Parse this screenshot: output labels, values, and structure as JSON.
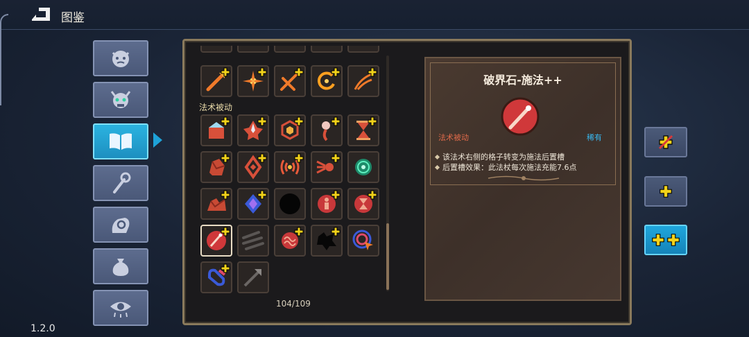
{
  "header": {
    "title": "图鉴"
  },
  "version": "1.2.0",
  "categories": [
    {
      "icon": "demon-face-icon",
      "active": false
    },
    {
      "icon": "horned-skull-icon",
      "active": false
    },
    {
      "icon": "book-icon",
      "active": true
    },
    {
      "icon": "staff-icon",
      "active": false
    },
    {
      "icon": "hand-orb-icon",
      "active": false
    },
    {
      "icon": "pouch-icon",
      "active": false
    },
    {
      "icon": "eye-icon",
      "active": false
    }
  ],
  "grid": {
    "section_label": "法术被动",
    "counter": "104/109",
    "top_row": [
      "fire-arrow-spell-icon",
      "flame-burst-spell-icon",
      "twin-fire-spell-icon",
      "fire-ring-spell-icon",
      "fire-claw-spell-icon"
    ],
    "passive_items": [
      [
        "ice-block-icon",
        "crystal-flower-icon",
        "hex-gem-icon",
        "spirit-wisp-icon",
        "hourglass-icon"
      ],
      [
        "rock-chunk-icon",
        "diamond-rune-icon",
        "signal-wave-icon",
        "triple-shot-icon",
        "green-orb-icon"
      ],
      [
        "boulder-icon",
        "blue-crystal-icon",
        "black-hole-icon",
        "red-figure-orb-icon",
        "red-hourglass-orb-icon"
      ],
      [
        "realm-stone-cast-icon",
        "triple-spike-icon",
        "brain-orb-icon",
        "dark-splat-icon",
        "target-cursor-icon"
      ],
      [
        "blue-loop-icon",
        "arrow-up-icon"
      ]
    ]
  },
  "detail": {
    "name": "破界石-施法++",
    "type": "法术被动",
    "rarity": "稀有",
    "effects": [
      "该法术右侧的格子转变为施法后置槽",
      "后置槽效果：此法杖每次施法充能7.6点"
    ]
  },
  "upgrade_levels": [
    {
      "icon": "no-plus-icon",
      "active": false
    },
    {
      "icon": "single-plus-icon",
      "active": false
    },
    {
      "icon": "double-plus-icon",
      "active": true
    }
  ],
  "colors": {
    "accent": "#1ea2d8",
    "passive": "#e06a4a",
    "rare": "#38b8f0",
    "plus": "#f2d21a"
  }
}
